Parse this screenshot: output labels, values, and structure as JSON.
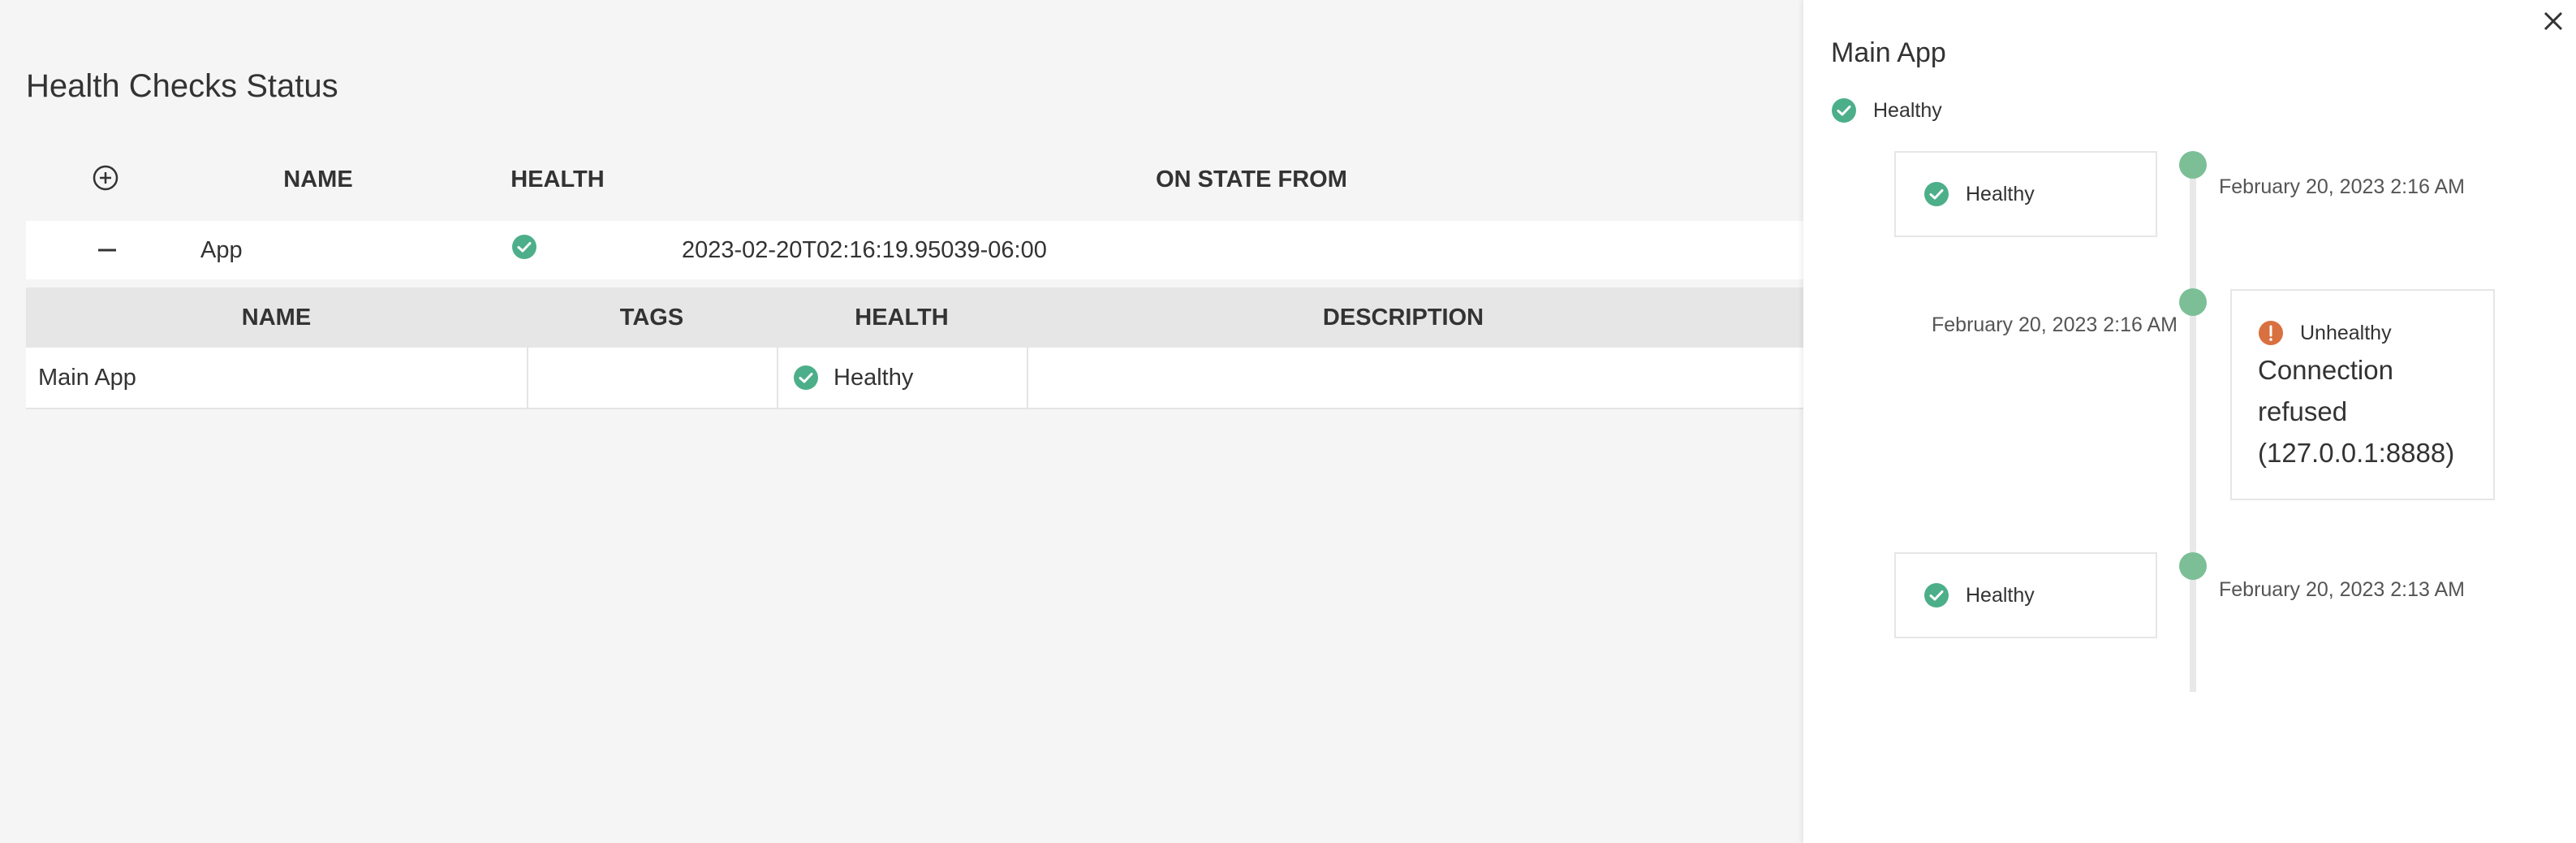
{
  "page": {
    "title": "Health Checks Status"
  },
  "outer_table": {
    "headers": {
      "name": "NAME",
      "health": "HEALTH",
      "on_state_from": "ON STATE FROM"
    },
    "row": {
      "name": "App",
      "health": "healthy",
      "on_state_from": "2023-02-20T02:16:19.95039-06:00"
    }
  },
  "inner_table": {
    "headers": {
      "name": "NAME",
      "tags": "TAGS",
      "health": "HEALTH",
      "description": "DESCRIPTION"
    },
    "row": {
      "name": "Main App",
      "tags": "",
      "health": "Healthy",
      "description": ""
    }
  },
  "drawer": {
    "title": "Main App",
    "status": "Healthy",
    "timeline": [
      {
        "status": "Healthy",
        "timestamp": "February 20, 2023 2:16 AM",
        "message": ""
      },
      {
        "status": "Unhealthy",
        "timestamp": "February 20, 2023 2:16 AM",
        "message": "Connection refused (127.0.0.1:8888)"
      },
      {
        "status": "Healthy",
        "timestamp": "February 20, 2023 2:13 AM",
        "message": ""
      }
    ]
  },
  "icons": {
    "add": "plus-circle-icon",
    "collapse": "minus-icon",
    "healthy": "check-circle-icon",
    "unhealthy": "exclamation-circle-icon",
    "close": "close-icon"
  },
  "colors": {
    "healthy": "#4caf8a",
    "unhealthy": "#d9703f",
    "timeline_dot": "#7cbf96",
    "background": "#f5f5f5",
    "inner_header": "#e6e6e6"
  }
}
